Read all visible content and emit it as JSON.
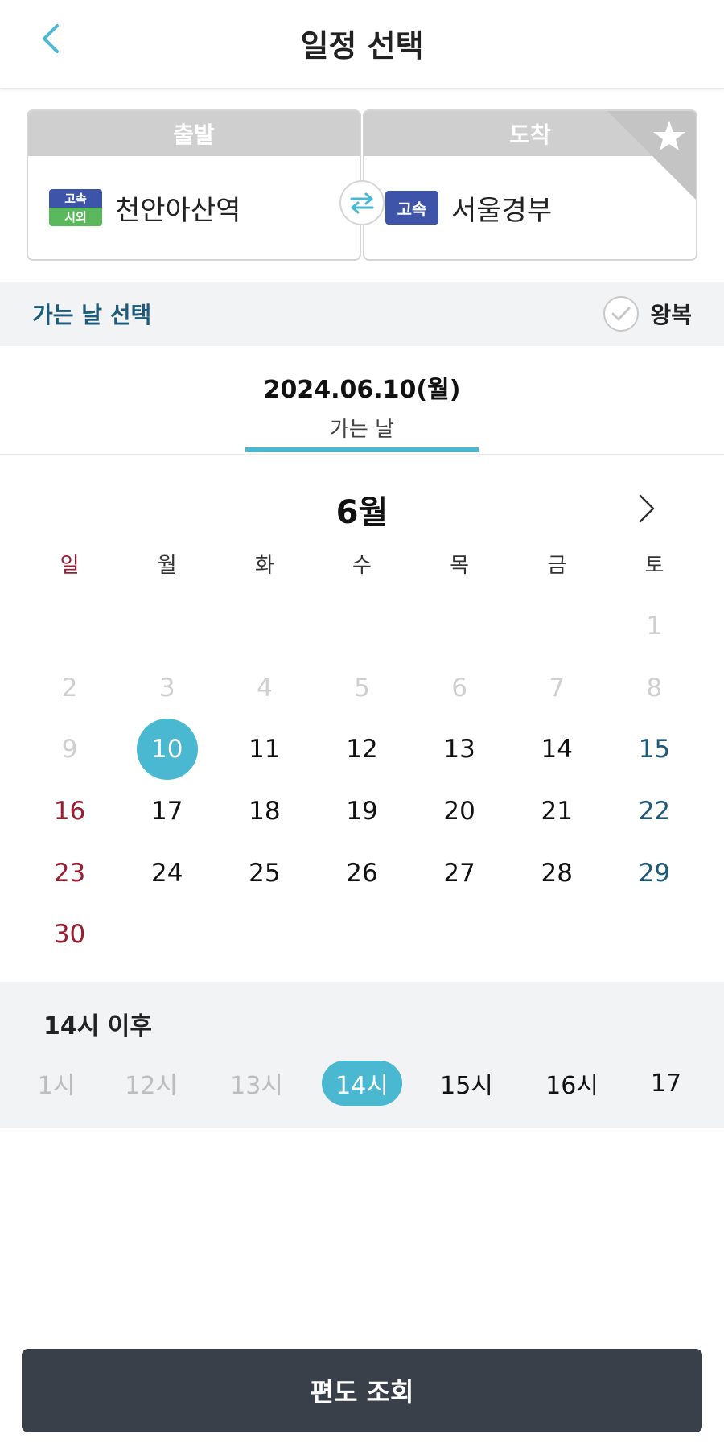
{
  "header": {
    "title": "일정 선택"
  },
  "route": {
    "departure": {
      "label": "출발",
      "badge_top": "고속",
      "badge_bottom": "시외",
      "station": "천안아산역"
    },
    "arrival": {
      "label": "도착",
      "badge": "고속",
      "station": "서울경부"
    }
  },
  "section": {
    "title": "가는 날 선택",
    "roundtrip_label": "왕복"
  },
  "date_tab": {
    "date": "2024.06.10(월)",
    "label": "가는 날"
  },
  "calendar": {
    "month": "6월",
    "weekdays": [
      "일",
      "월",
      "화",
      "수",
      "목",
      "금",
      "토"
    ],
    "days": [
      "1",
      "2",
      "3",
      "4",
      "5",
      "6",
      "7",
      "8",
      "9",
      "10",
      "11",
      "12",
      "13",
      "14",
      "15",
      "16",
      "17",
      "18",
      "19",
      "20",
      "21",
      "22",
      "23",
      "24",
      "25",
      "26",
      "27",
      "28",
      "29",
      "30"
    ],
    "selected_day": "10"
  },
  "time": {
    "label": "14시 이후",
    "items": [
      "1시",
      "12시",
      "13시",
      "14시",
      "15시",
      "16시",
      "17"
    ],
    "selected": "14시"
  },
  "colors": {
    "accent": "#4ab8d0",
    "sunday": "#9b1b30",
    "saturday": "#1e5a7a",
    "button": "#3a404a"
  },
  "footer": {
    "search_label": "편도 조회"
  }
}
